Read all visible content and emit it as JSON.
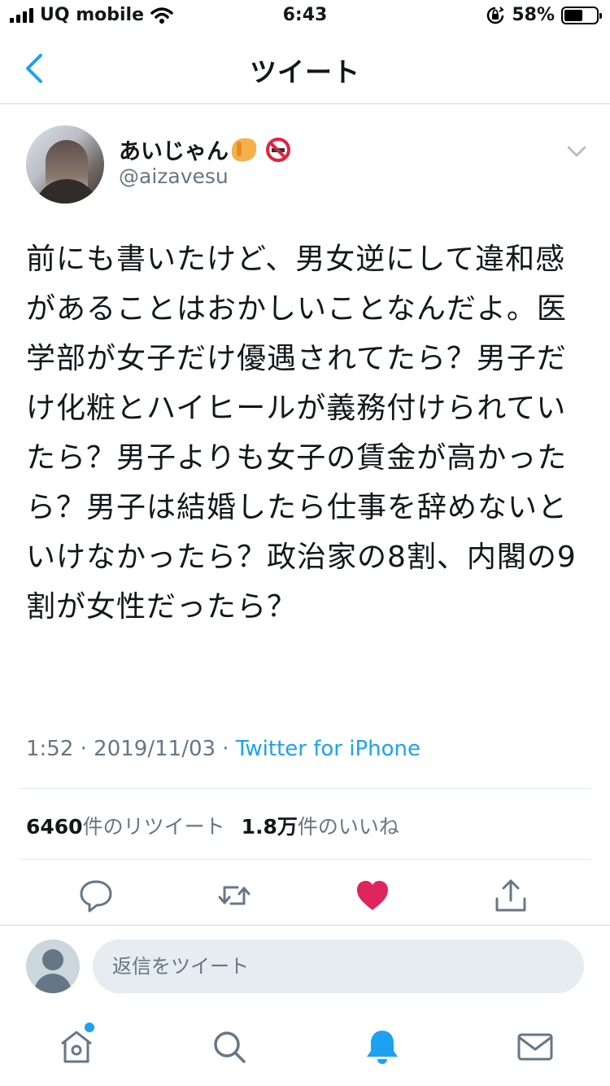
{
  "status_bar": {
    "carrier": "UQ mobile",
    "time": "6:43",
    "battery_percent_label": "58%",
    "battery_level": 0.58
  },
  "nav": {
    "title": "ツイート"
  },
  "tweet": {
    "display_name": "あいじゃん",
    "handle": "@aizavesu",
    "text": "前にも書いたけど、男女逆にして違和感があることはおかしいことなんだよ。医学部が女子だけ優遇されてたら？男子だけ化粧とハイヒールが義務付けられていたら？男子よりも女子の賃金が高かったら？男子は結婚したら仕事を辞めないといけなかったら？政治家の8割、内閣の9割が女性だったら？",
    "timestamp": "1:52 · 2019/11/03 · ",
    "source": "Twitter for iPhone",
    "retweet_count": "6460",
    "retweet_label": "件のリツイート",
    "like_count": "1.8万",
    "like_label": "件のいいね",
    "liked": true
  },
  "reply": {
    "placeholder": "返信をツイート"
  },
  "colors": {
    "accent": "#1da1f2",
    "like": "#e0245e",
    "secondary_text": "#657786"
  },
  "icons": {
    "back": "chevron-left-icon",
    "caret": "chevron-down-icon",
    "reply": "reply-icon",
    "retweet": "retweet-icon",
    "like": "heart-icon",
    "share": "share-icon",
    "home": "home-icon",
    "search": "search-icon",
    "notifications": "bell-icon",
    "messages": "mail-icon"
  }
}
